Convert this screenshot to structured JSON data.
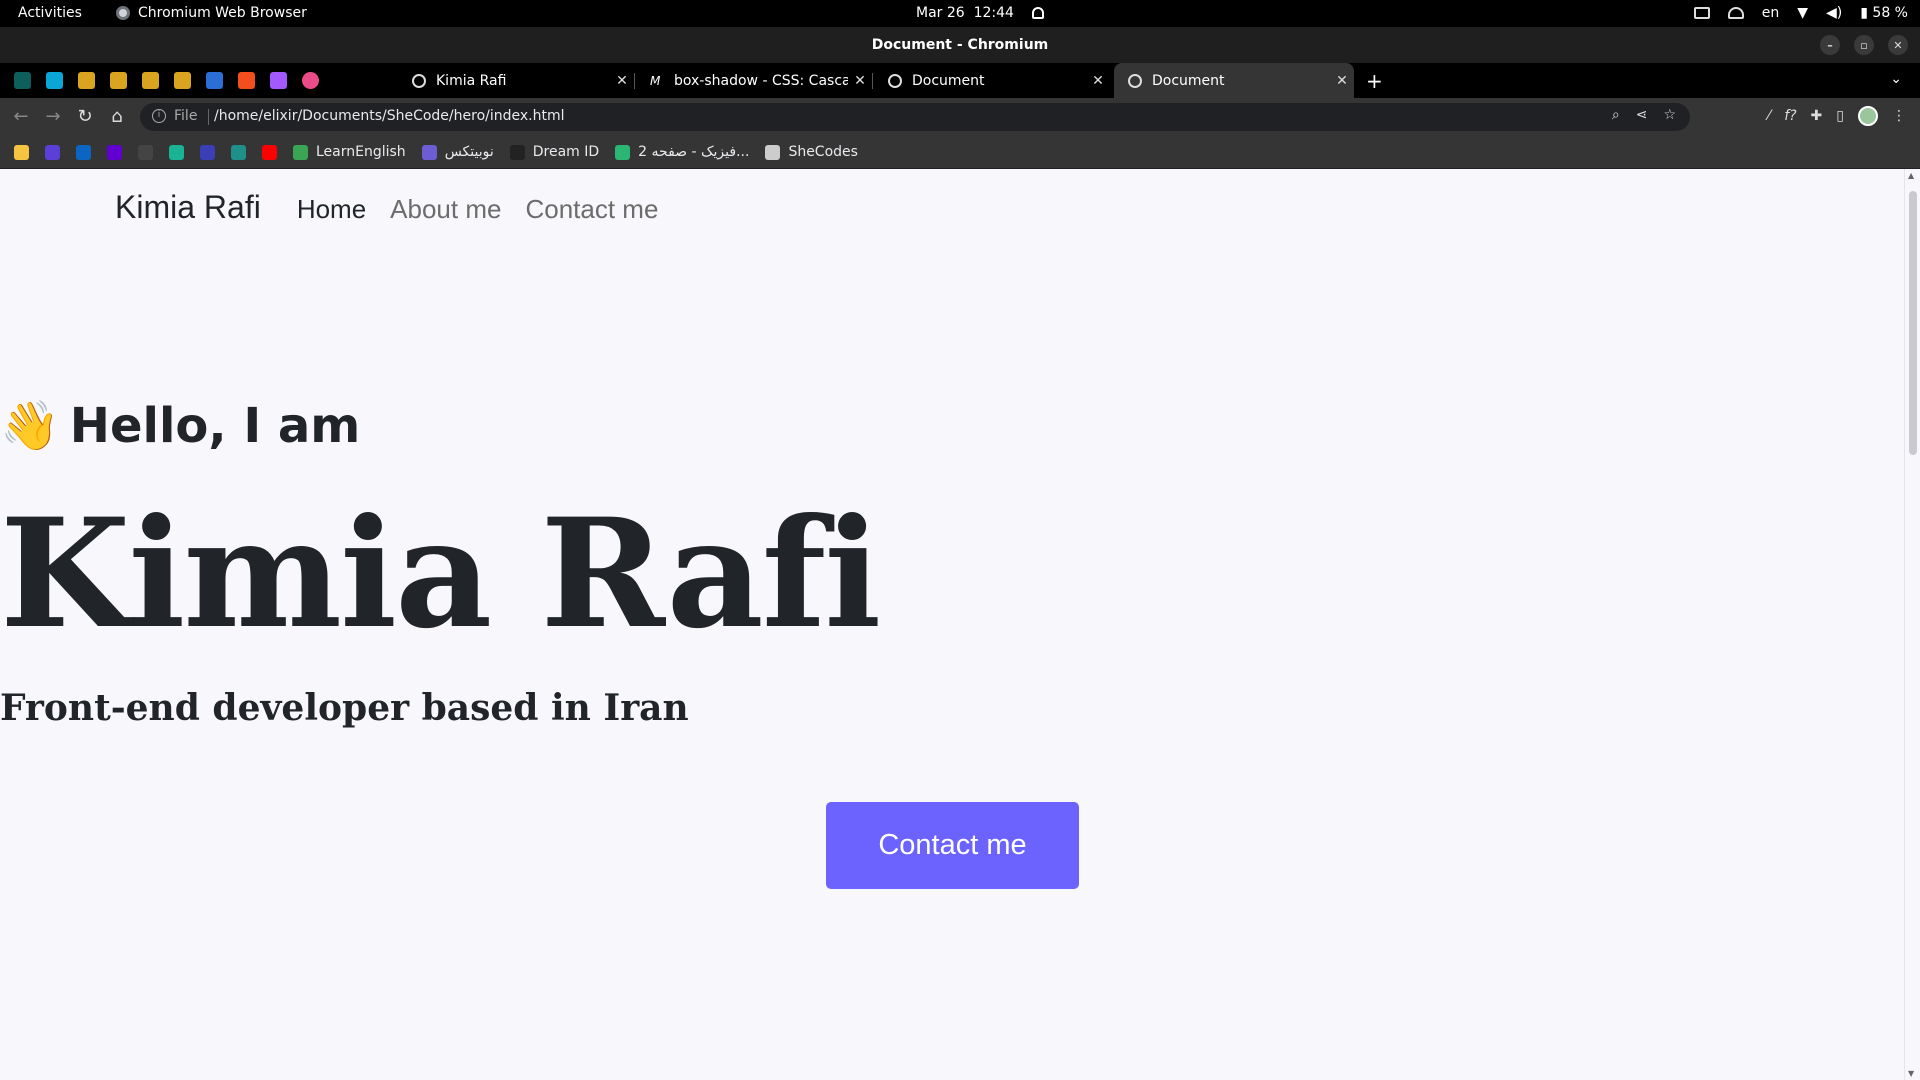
{
  "os": {
    "activities": "Activities",
    "app_name": "Chromium Web Browser",
    "date": "Mar 26",
    "time": "12:44",
    "lang": "en",
    "battery": "58 %"
  },
  "window": {
    "title": "Document - Chromium"
  },
  "tabs": [
    {
      "label": "Kimia Rafi",
      "active": false
    },
    {
      "label": "box-shadow - CSS: Cascad",
      "active": false
    },
    {
      "label": "Document",
      "active": false
    },
    {
      "label": "Document",
      "active": true
    }
  ],
  "toolbar": {
    "scheme": "File",
    "url": "/home/elixir/Documents/SheCode/hero/index.html"
  },
  "bookmarks": [
    {
      "label": "",
      "icon": "bookmark-icon",
      "color": "#f5c542"
    },
    {
      "label": "",
      "icon": "bookmark-icon",
      "color": "#5b3fd6"
    },
    {
      "label": "",
      "icon": "linkedin-icon",
      "color": "#0a66c2"
    },
    {
      "label": "",
      "icon": "yahoo-icon",
      "color": "#6001d2"
    },
    {
      "label": "",
      "icon": "github-icon",
      "color": "#444444"
    },
    {
      "label": "",
      "icon": "diamond-icon",
      "color": "#1ab394"
    },
    {
      "label": "",
      "icon": "bookmark-icon",
      "color": "#3b3fb6"
    },
    {
      "label": "",
      "icon": "bookmark-icon",
      "color": "#1f8f8a"
    },
    {
      "label": "",
      "icon": "youtube-icon",
      "color": "#ff0000"
    },
    {
      "label": "LearnEnglish",
      "icon": "learnenglish-icon",
      "color": "#3aa655"
    },
    {
      "label": "نوبیتکس",
      "icon": "nobitex-icon",
      "color": "#6c5dd3"
    },
    {
      "label": "Dream ID",
      "icon": "dreamid-icon",
      "color": "#222222"
    },
    {
      "label": "فیزیک - صفحه 2...",
      "icon": "physics-icon",
      "color": "#2bb673"
    },
    {
      "label": "SheCodes",
      "icon": "folder-icon",
      "color": "#cccccc"
    }
  ],
  "site": {
    "brand": "Kimia Rafi",
    "nav": [
      "Home",
      "About me",
      "Contact me"
    ],
    "greeting": "Hello, I am",
    "wave": "👋",
    "name": "Kimia Rafi",
    "subtitle": "Front-end developer based in Iran",
    "cta": "Contact me"
  },
  "colors": {
    "accent": "#6c63ff",
    "text": "#212529",
    "page_bg": "#f8f8fc"
  }
}
